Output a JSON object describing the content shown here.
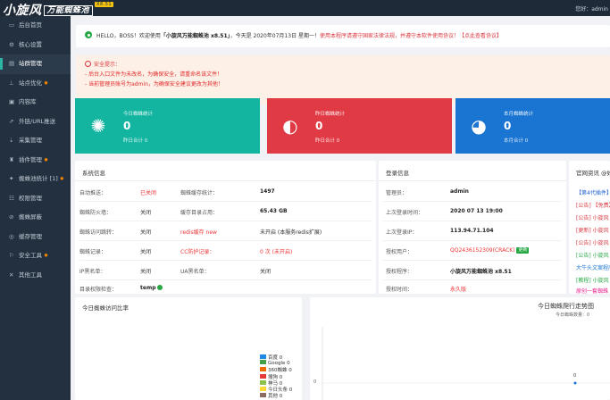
{
  "app": {
    "logo_main": "小旋风",
    "logo_sub": "万能蜘蛛池",
    "logo_version": "X8.51",
    "top_user": "您好：admin"
  },
  "sidebar": {
    "items": [
      {
        "label": "后台首页",
        "icon": "monitor-icon"
      },
      {
        "label": "核心设置",
        "icon": "gear-icon"
      },
      {
        "label": "站群管理",
        "icon": "layers-icon"
      },
      {
        "label": "站点优化",
        "icon": "chart-icon"
      },
      {
        "label": "内容库",
        "icon": "database-icon"
      },
      {
        "label": "外链/URL推送",
        "icon": "link-icon"
      },
      {
        "label": "采集管理",
        "icon": "download-icon"
      },
      {
        "label": "插件管理",
        "icon": "puzzle-icon"
      },
      {
        "label": "蜘蛛池统计 [1]",
        "icon": "spider-icon"
      },
      {
        "label": "权限管理",
        "icon": "users-icon"
      },
      {
        "label": "蜘蛛屏蔽",
        "icon": "block-icon"
      },
      {
        "label": "缓存管理",
        "icon": "cache-icon"
      },
      {
        "label": "安全工具",
        "icon": "shield-icon"
      },
      {
        "label": "其他工具",
        "icon": "tools-icon"
      }
    ],
    "star": "✸"
  },
  "hello": {
    "greeting": "HELLO，BOSS！欢迎使用",
    "product": "「小旋风万能蜘蛛池 x8.51」",
    "date_text": "，今天是 2020年07月13日 星期一！",
    "notice": "使用本程序请遵守国家法律法规，并遵守本软件使用协议！【点此查看协议】"
  },
  "warning": {
    "title": "安全提示：",
    "lines": [
      "- 后台入口文件为未改名，为确保安全，请重命名该文件！",
      "- 当前管理员账号为admin，为确保安全建议更改为其他！"
    ]
  },
  "stats": [
    {
      "title": "今日蜘蛛统计",
      "value": "0",
      "sub": "昨日合计 0",
      "color": "#13b5a1",
      "icon": "sun-icon",
      "glyph": "✺"
    },
    {
      "title": "昨日蜘蛛统计",
      "value": "0",
      "sub": "昨日合计 0",
      "color": "#e03b44",
      "icon": "half-circle-icon",
      "glyph": "◐"
    },
    {
      "title": "本月蜘蛛统计",
      "value": "0",
      "sub": "本月合计 0",
      "color": "#1a74d1",
      "icon": "globe-icon",
      "glyph": "◕"
    }
  ],
  "sysinfo": {
    "title": "系统信息",
    "rows": [
      [
        {
          "l": "自动推送：",
          "v": "已关闭",
          "c": "red"
        },
        {
          "l": "蜘蛛缓存统计：",
          "v": "1497",
          "c": "b"
        }
      ],
      [
        {
          "l": "蜘蛛防火墙：",
          "v": "关闭",
          "c": ""
        },
        {
          "l": "缓存目录占用：",
          "v": "65.43 GB",
          "c": "b"
        }
      ],
      [
        {
          "l": "蜘蛛访问跳转：",
          "v": "关闭",
          "c": ""
        },
        {
          "l": "redis缓存 new",
          "v": "未开启 (本服务redis扩展)",
          "c": "",
          "lc": "red"
        }
      ],
      [
        {
          "l": "蜘蛛记录：",
          "v": "关闭",
          "c": ""
        },
        {
          "l": "CC防护记录：",
          "v": "0 次 (未开启)",
          "c": "red",
          "lc": "red"
        }
      ],
      [
        {
          "l": "IP黑名单：",
          "v": "关闭",
          "c": ""
        },
        {
          "l": "UA黑名单：",
          "v": "关闭",
          "c": ""
        }
      ]
    ],
    "tmp_label": "目录权限检查：",
    "tmp_value": "temp"
  },
  "account": {
    "title": "登录信息",
    "rows": [
      {
        "l": "管理员：",
        "v": "admin",
        "c": "b"
      },
      {
        "l": "上次登录时间：",
        "v": "2020 07 13 19:00",
        "c": "b"
      },
      {
        "l": "上次登录IP：",
        "v": "113.94.71.104",
        "c": "b"
      },
      {
        "l": "授权用户：",
        "v": "QQ2436152309(CRACK)",
        "c": "red",
        "badge": "更新"
      },
      {
        "l": "授权程序：",
        "v": "小旋风万能蜘蛛池 x8.51",
        "c": "b"
      },
      {
        "l": "授权时间：",
        "v": "永久版",
        "c": "red"
      }
    ]
  },
  "news": {
    "title": "官网资讯 @好",
    "items": [
      {
        "text": "【第4代插件】",
        "color": "#1a5fd1"
      },
      {
        "text": "[公告] 【免费】",
        "color": "#d9363e"
      },
      {
        "text": "[公告] 小旋风",
        "color": "#d9363e"
      },
      {
        "text": "[更新] 小旋风",
        "color": "#d9363e"
      },
      {
        "text": "[公告] 小旋风",
        "color": "#d9363e"
      },
      {
        "text": "[公告] 小旋风",
        "color": "#27a844"
      },
      {
        "text": "大牛头文案程序",
        "color": "#1a74d1"
      },
      {
        "text": "[教程] 小旋风",
        "color": "#27a844"
      },
      {
        "text": "原创一套蜘蛛",
        "color": "#e91e8c"
      }
    ]
  },
  "pie": {
    "title": "今日蜘蛛访问比率",
    "legend": [
      {
        "name": "百度 0",
        "color": "#1e88e5"
      },
      {
        "name": "Google 0",
        "color": "#43a047"
      },
      {
        "name": "360蜘蛛 0",
        "color": "#ef6c00"
      },
      {
        "name": "搜狗 0",
        "color": "#e53935"
      },
      {
        "name": "神马 0",
        "color": "#8bc34a"
      },
      {
        "name": "今日头条 0",
        "color": "#fdd835"
      },
      {
        "name": "其他 0",
        "color": "#8d6e63"
      }
    ]
  },
  "trend": {
    "title": "今日蜘蛛爬行走势图",
    "subtitle": "今日蜘蛛数量：0",
    "y_tick": "0",
    "point_label": "0"
  },
  "chart_data": {
    "type": "pie",
    "title": "今日蜘蛛访问比率",
    "categories": [
      "百度",
      "Google",
      "360蜘蛛",
      "搜狗",
      "神马",
      "今日头条",
      "其他"
    ],
    "values": [
      0,
      0,
      0,
      0,
      0,
      0,
      0
    ]
  }
}
